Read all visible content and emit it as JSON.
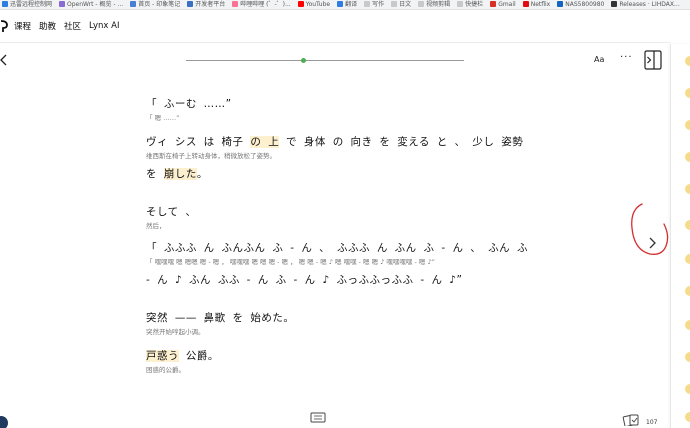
{
  "bookmarks": [
    {
      "label": "迅雷远程控制网",
      "color": "#2f7de1"
    },
    {
      "label": "OpenWrt - 概览 - ...",
      "color": "#8a6bd1"
    },
    {
      "label": "首页 - 印象笔记",
      "color": "#4a7fd6"
    },
    {
      "label": "开发者平台",
      "color": "#3b6fc4"
    },
    {
      "label": "哔哩哔哩 (゜-゜)...",
      "color": "#fb7299"
    },
    {
      "label": "YouTube",
      "color": "#ff0000"
    },
    {
      "label": "翻译",
      "color": "#2f7de1"
    },
    {
      "label": "写作",
      "color": "#c9c9c9"
    },
    {
      "label": "日文",
      "color": "#c9c9c9"
    },
    {
      "label": "视频剪辑",
      "color": "#c9c9c9"
    },
    {
      "label": "快捷栏",
      "color": "#c9c9c9"
    },
    {
      "label": "Gmail",
      "color": "#d93025"
    },
    {
      "label": "Netflix",
      "color": "#e50914"
    },
    {
      "label": "NAS5800980",
      "color": "#1565c0"
    },
    {
      "label": "Releases · LIHDAX...",
      "color": "#333333"
    }
  ],
  "nav": {
    "items": [
      "课程",
      "助教",
      "社区",
      "Lynx AI"
    ]
  },
  "toolbar": {
    "font_label": "Aa",
    "more_label": "···",
    "progress": 0.42
  },
  "paragraphs": [
    {
      "jp": "「 ふーむ ……”",
      "zh": "「 嗯 ……”",
      "top": 0
    },
    {
      "jp_parts": [
        {
          "t": "ヴィ シス は 椅子 ",
          "hl": false
        },
        {
          "t": "の 上",
          "hl": true
        },
        {
          "t": " で 身体 の 向き を 変える と 、 少し 姿勢",
          "hl": false
        }
      ],
      "zh": "维西斯在椅子上转动身体，稍微放松了姿势。"
    },
    {
      "jp_parts": [
        {
          "t": "を ",
          "hl": false
        },
        {
          "t": "崩した",
          "hl": true
        },
        {
          "t": "。",
          "hl": false
        }
      ],
      "zh": ""
    },
    {
      "jp": "そして 、",
      "zh": "然后，"
    },
    {
      "jp": "「 ふふふ ん ふんふん ふ - ん 、 ふふふ ん ふん ふ - ん 、 ふん ふ",
      "zh": "「 嘿嘿嘿 嗯 嗯嗯 嗯 - 嗯 ， 嘿嘿嘿 嗯 嗯 嗯 - 嗯 ， 嗯 嗯 - 嗯 ♪ 嗯 嘿嘿 - 嗯 嗯 ♪ 嘿嘿嘿嘿 - 嗯 ♪”"
    },
    {
      "jp": "- ん ♪ ふん ふふ - ん ふ - ん ♪ ふっふふっふふ - ん ♪”",
      "zh": ""
    },
    {
      "jp_parts": [
        {
          "t": "突然 —— 鼻歌 を 始めた。",
          "hl": false
        }
      ],
      "zh": "突然开始哼起小调。"
    },
    {
      "jp_parts": [
        {
          "t": "戸惑う",
          "hl": true
        },
        {
          "t": " 公爵。",
          "hl": false
        }
      ],
      "zh": "困惑的公爵。"
    }
  ],
  "footer": {
    "page_count": "107"
  }
}
